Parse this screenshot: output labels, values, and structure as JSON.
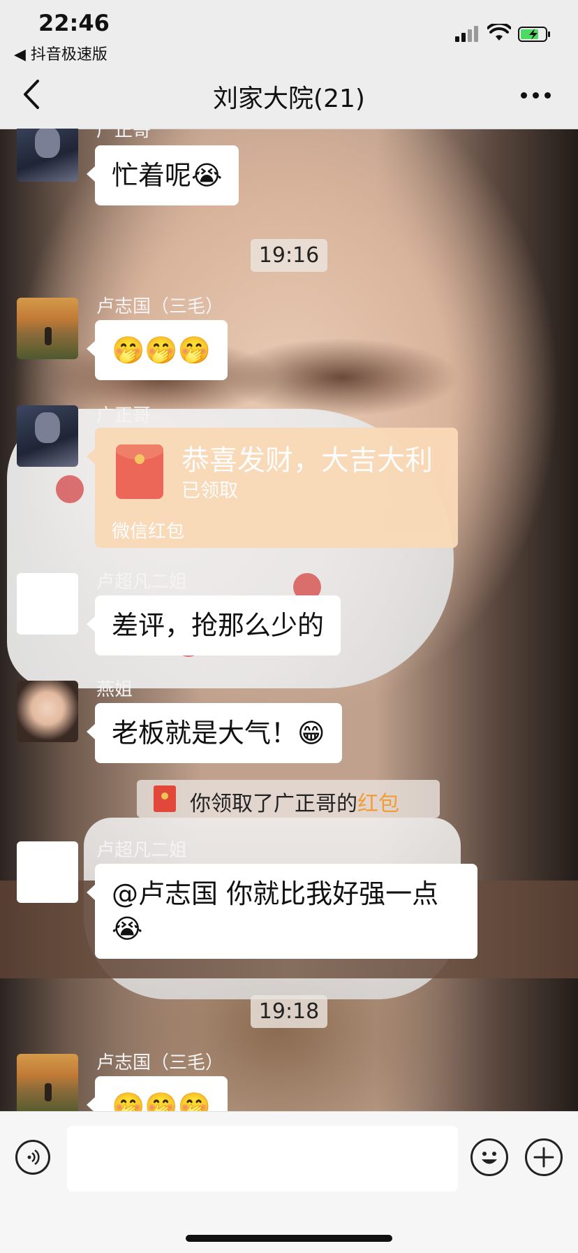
{
  "status_bar": {
    "time": "22:46",
    "back_to_app": "◀ 抖音极速版",
    "icons": [
      "cellular-signal-icon",
      "wifi-icon",
      "battery-charging-icon"
    ]
  },
  "nav": {
    "title": "刘家大院(21)",
    "icons": [
      "back-chevron-icon",
      "more-icon"
    ]
  },
  "messages": [
    {
      "sender": "广正哥",
      "text": "忙着呢😭"
    },
    {
      "timestamp": "19:16"
    },
    {
      "sender": "卢志国（三毛）",
      "text": "🤭🤭🤭"
    },
    {
      "sender": "广正哥",
      "red_packet": {
        "title": "恭喜发财，大吉大利",
        "status": "已领取",
        "footer": "微信红包"
      }
    },
    {
      "sender": "卢超凡二姐",
      "text": "差评，抢那么少的"
    },
    {
      "sender": "燕姐",
      "text": "老板就是大气！😁"
    },
    {
      "system": {
        "prefix": "你领取了广正哥的",
        "link": "红包"
      }
    },
    {
      "sender": "卢超凡二姐",
      "text_line1": "@卢志国 你就比我好强一点",
      "text_line2": "😭"
    },
    {
      "timestamp": "19:18"
    },
    {
      "sender": "卢志国（三毛）",
      "text": "🤭🤭🤭"
    }
  ],
  "input_bar": {
    "placeholder": "",
    "icons": [
      "voice-icon",
      "emoji-icon",
      "plus-icon"
    ]
  },
  "colors": {
    "nav_bg": "#ededed",
    "bubble_bg": "#ffffff",
    "red_packet_bg": "#f9d9b6",
    "link_orange": "#f29c38"
  }
}
